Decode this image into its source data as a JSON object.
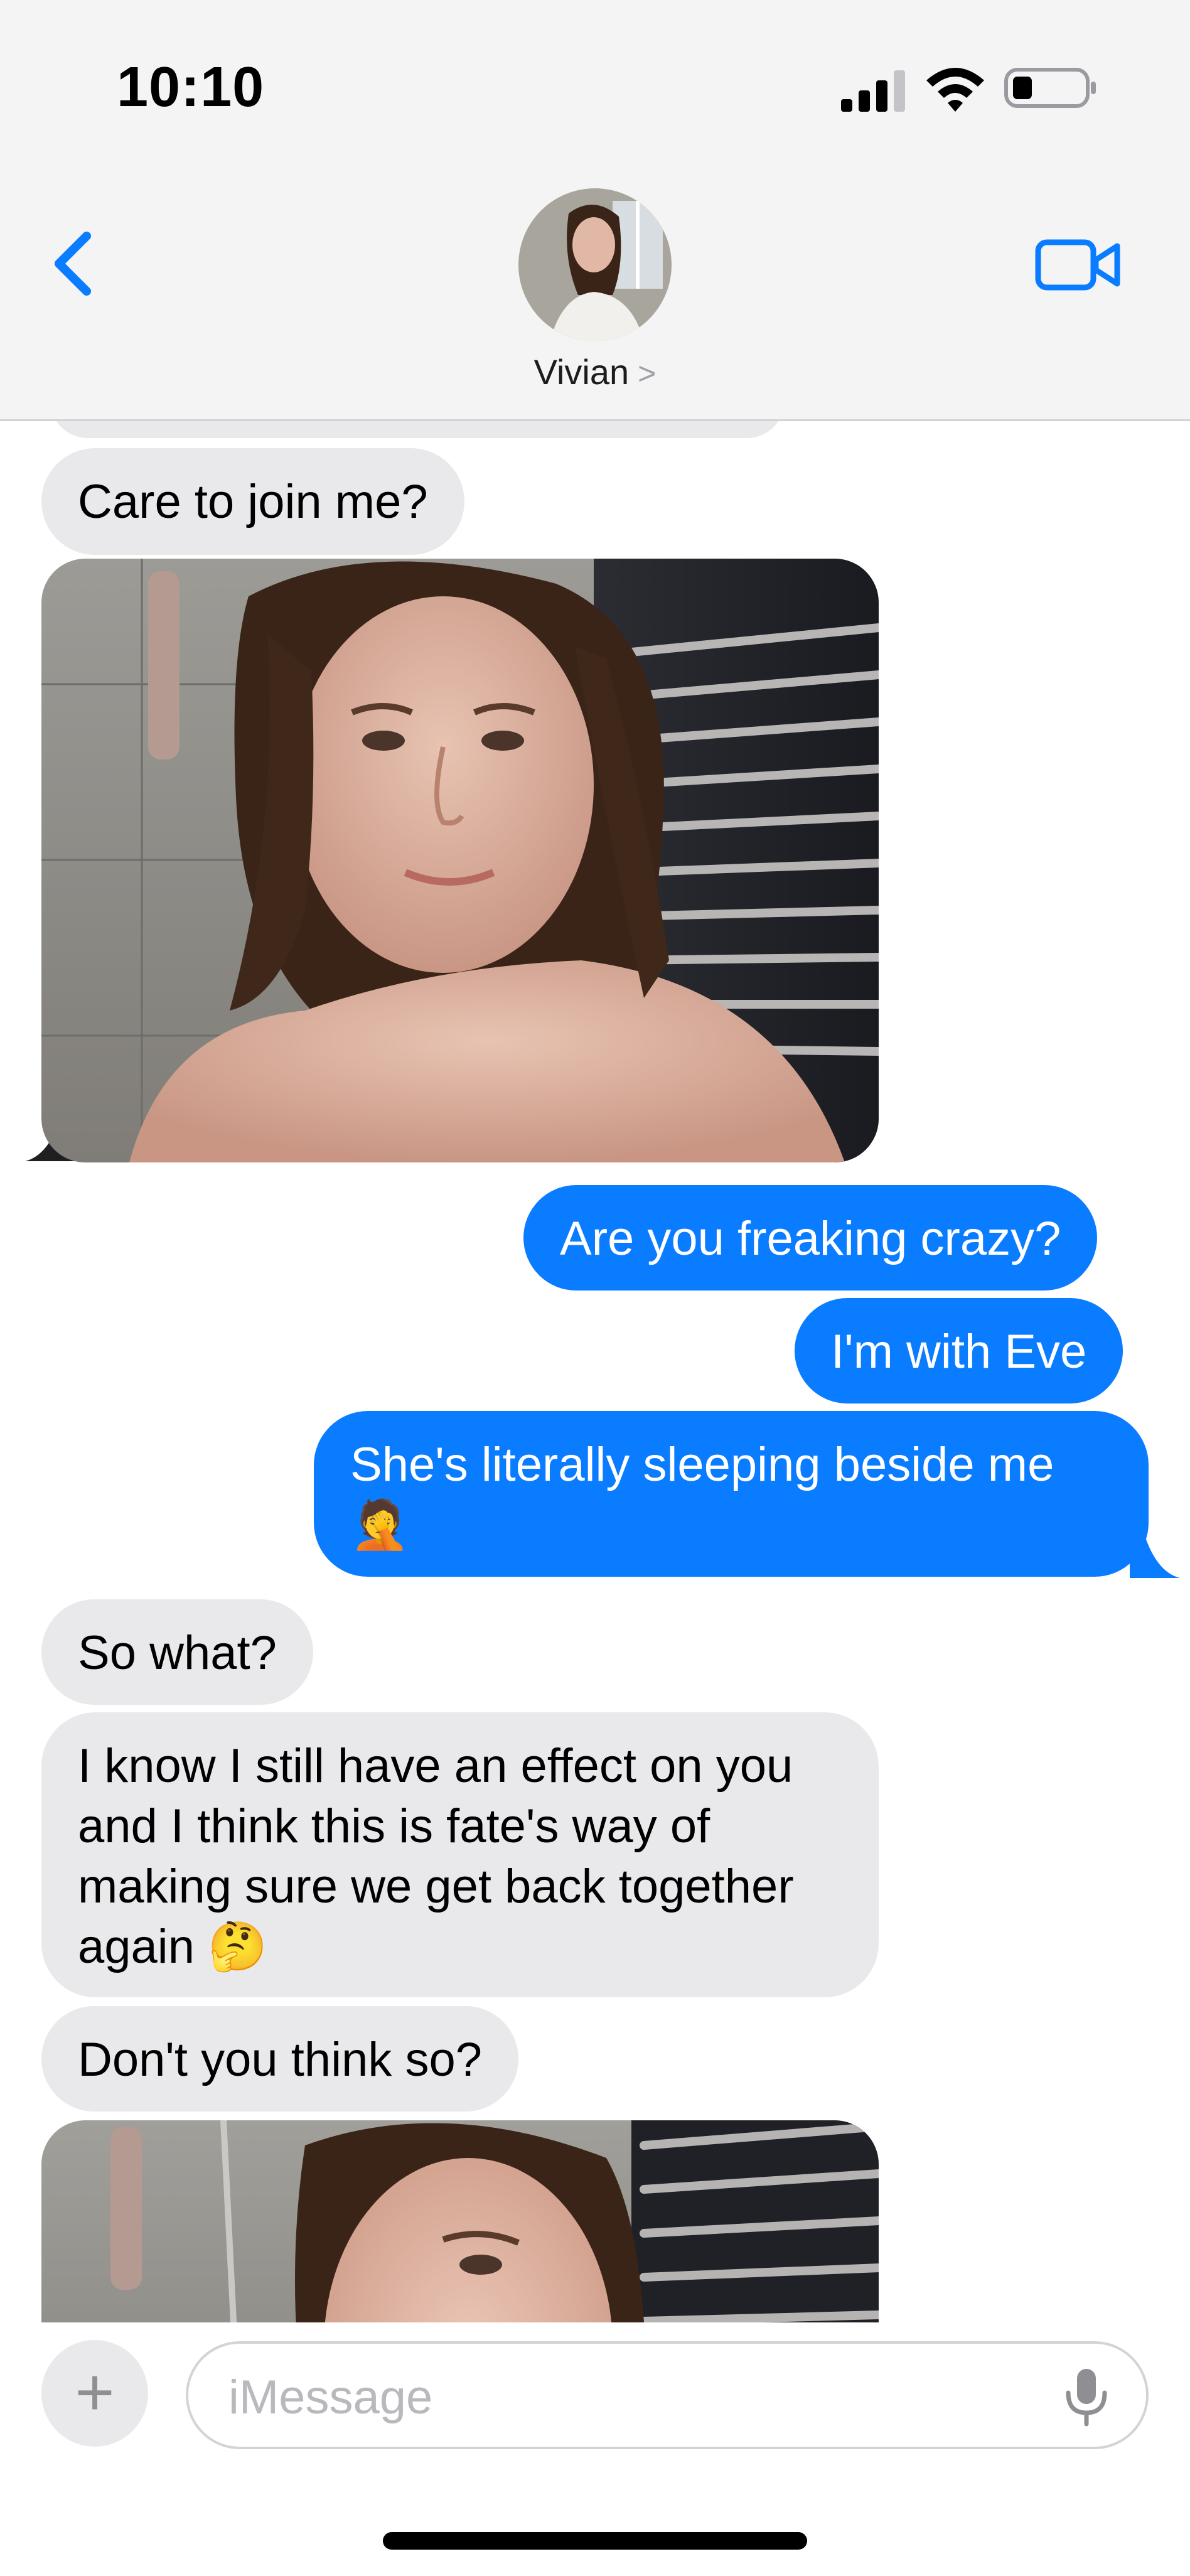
{
  "status_bar": {
    "time": "10:10"
  },
  "header": {
    "contact_name": "Vivian",
    "contact_chevron": ">",
    "back_icon": "chevron-left",
    "video_icon": "video-camera",
    "accent_color": "#0a7cff"
  },
  "messages": [
    {
      "direction": "incoming",
      "text": "Care to join me?"
    },
    {
      "direction": "incoming",
      "type": "photo"
    },
    {
      "direction": "outgoing",
      "text": "Are you freaking crazy?"
    },
    {
      "direction": "outgoing",
      "text": "I'm with Eve"
    },
    {
      "direction": "outgoing",
      "text": "She's literally sleeping beside me 🤦"
    },
    {
      "direction": "incoming",
      "text": "So what?"
    },
    {
      "direction": "incoming",
      "text": "I know I still have an effect on you and I think this is fate's way of making sure we get back together again 🤔"
    },
    {
      "direction": "incoming",
      "text": "Don't you think so?"
    },
    {
      "direction": "incoming",
      "type": "photo"
    }
  ],
  "compose": {
    "placeholder": "iMessage",
    "plus_label": "+",
    "mic_icon": "microphone"
  },
  "colors": {
    "incoming_bubble": "#e9e9eb",
    "outgoing_bubble": "#0a7cff",
    "header_bg": "#f4f4f5"
  }
}
